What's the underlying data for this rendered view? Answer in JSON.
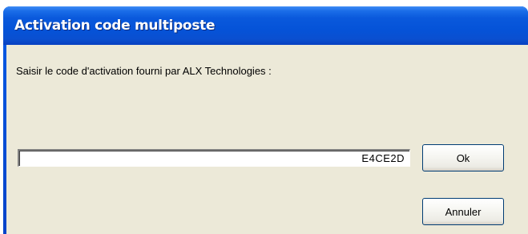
{
  "window": {
    "title": "Activation code multiposte"
  },
  "dialog": {
    "prompt": "Saisir le code d'activation fourni par ALX Technologies :",
    "code_value": "E4CE2D",
    "ok_label": "Ok",
    "cancel_label": "Annuler"
  },
  "colors": {
    "titlebar": "#0553d8",
    "client": "#ece9d8",
    "button_border": "#003c74"
  }
}
